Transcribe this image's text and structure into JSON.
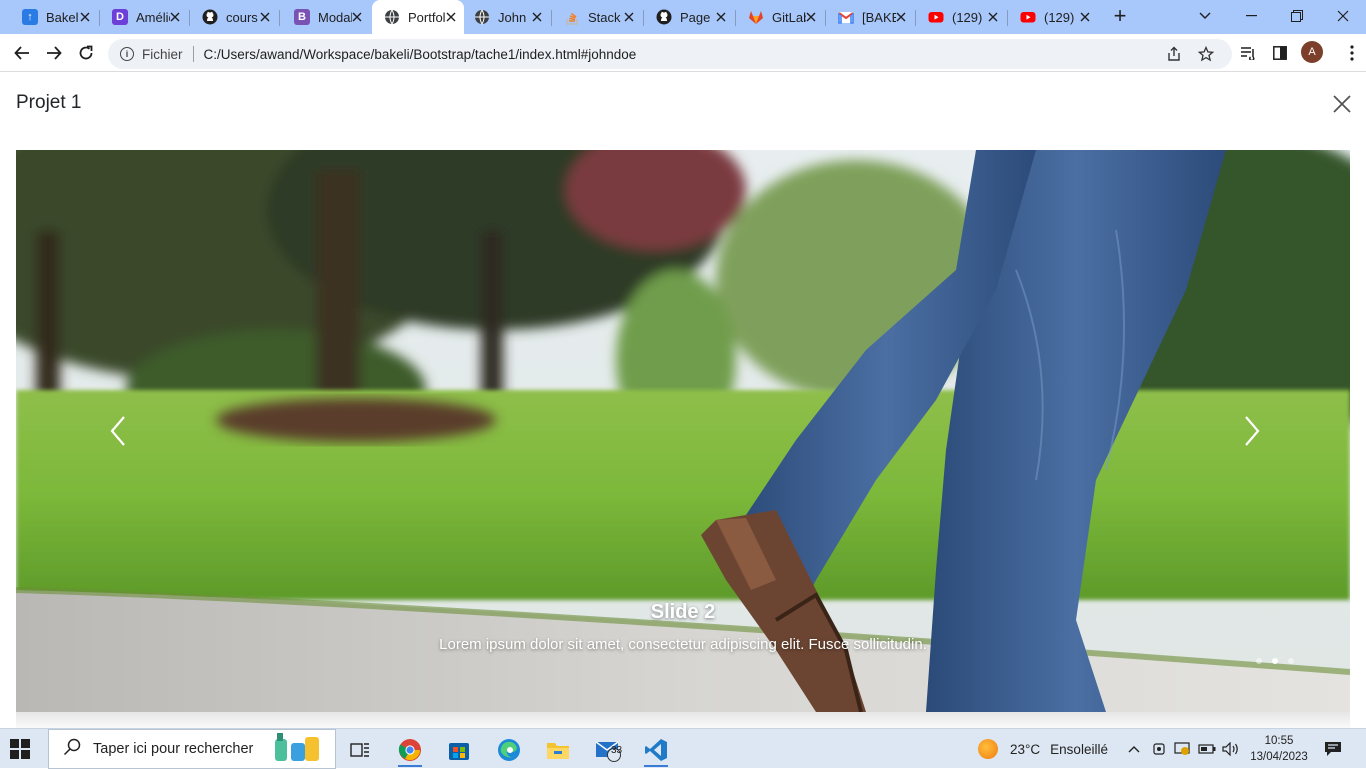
{
  "browser": {
    "tabs": [
      {
        "title": "Bakel",
        "favicon_color": "#2a7be4",
        "favicon_glyph": "↑"
      },
      {
        "title": "Amélie",
        "favicon_color": "#6b3fd8",
        "favicon_glyph": "D"
      },
      {
        "title": "cours",
        "favicon_color": "#1f1f1f",
        "favicon_glyph": "github-icon"
      },
      {
        "title": "Modal",
        "favicon_color": "#7952b3",
        "favicon_glyph": "B"
      },
      {
        "title": "Portfolio",
        "favicon_color": "#3c4043",
        "favicon_glyph": "globe-icon"
      },
      {
        "title": "John",
        "favicon_color": "#3c4043",
        "favicon_glyph": "globe-icon"
      },
      {
        "title": "Stack",
        "favicon_color": "#f48024",
        "favicon_glyph": "stackoverflow-icon"
      },
      {
        "title": "Page",
        "favicon_color": "#1f1f1f",
        "favicon_glyph": "github-icon"
      },
      {
        "title": "GitLab",
        "favicon_color": "#e24329",
        "favicon_glyph": "gitlab-icon"
      },
      {
        "title": "[BAKELI]",
        "favicon_color": "#ea4335",
        "favicon_glyph": "gmail-icon"
      },
      {
        "title": "(129)",
        "favicon_color": "#ff0000",
        "favicon_glyph": "youtube-icon"
      },
      {
        "title": "(129)",
        "favicon_color": "#ff0000",
        "favicon_glyph": "youtube-icon"
      }
    ],
    "active_tab_index": 4,
    "address": {
      "scheme_label": "Fichier",
      "url": "C:/Users/awand/Workspace/bakeli/Bootstrap/tache1/index.html#johndoe"
    },
    "profile_initial": "A"
  },
  "modal": {
    "title": "Projet 1"
  },
  "carousel": {
    "caption_title": "Slide 2",
    "caption_text": "Lorem ipsum dolor sit amet, consectetur adipiscing elit. Fusce sollicitudin.",
    "indicator_count": 3,
    "active_index": 1
  },
  "taskbar": {
    "search_placeholder": "Taper ici pour rechercher",
    "mail_badge": "33",
    "weather_temp": "23°C",
    "weather_desc": "Ensoleillé",
    "time": "10:55",
    "date": "13/04/2023"
  },
  "colors": {
    "tabstrip": "#a8c7fa",
    "taskbar": "#dde7f3",
    "accent": "#3a7bd5"
  }
}
